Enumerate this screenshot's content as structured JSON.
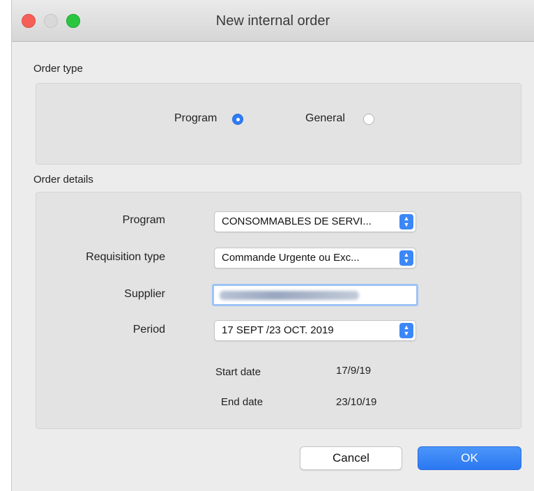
{
  "window": {
    "title": "New internal order"
  },
  "order_type": {
    "label": "Order type",
    "options": [
      {
        "label": "Program",
        "selected": true
      },
      {
        "label": "General",
        "selected": false
      }
    ]
  },
  "order_details": {
    "label": "Order details",
    "program": {
      "label": "Program",
      "value": "CONSOMMABLES DE SERVI..."
    },
    "requisition_type": {
      "label": "Requisition type",
      "value": "Commande Urgente ou Exc..."
    },
    "supplier": {
      "label": "Supplier"
    },
    "period": {
      "label": "Period",
      "value": "17 SEPT /23 OCT. 2019"
    },
    "start_date": {
      "label": "Start date",
      "value": "17/9/19"
    },
    "end_date": {
      "label": "End date",
      "value": "23/10/19"
    }
  },
  "buttons": {
    "cancel": "Cancel",
    "ok": "OK"
  },
  "colors": {
    "accent": "#2f7cf6",
    "close": "#f65f58",
    "maximize": "#2ac640"
  }
}
